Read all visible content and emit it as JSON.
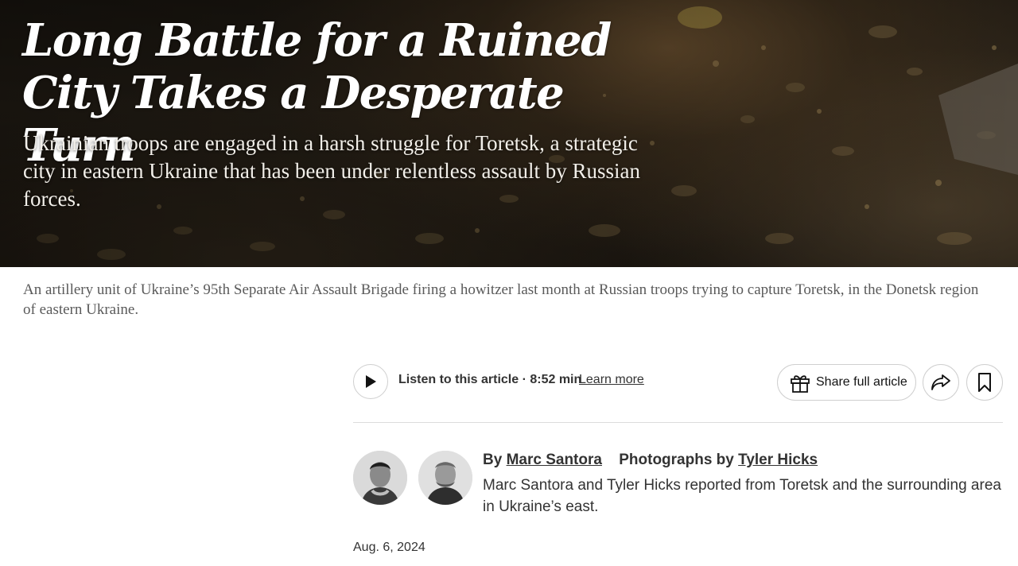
{
  "hero": {
    "headline_line1": "Long Battle for a Ruined",
    "headline_line2": "City Takes a Desperate Turn",
    "dek": "Ukrainian troops are engaged in a harsh struggle for Toretsk, a strategic city in eastern Ukraine that has been under relentless assault by Russian forces."
  },
  "caption": "An artillery unit of Ukraine’s 95th Separate Air Assault Brigade firing a howitzer last month at Russian troops trying to capture Toretsk, in the Donetsk region of eastern Ukraine.",
  "toolbar": {
    "listen_label": "Listen to this article · 8:52 min",
    "learn_more": "Learn more",
    "share_label": "Share full article",
    "icons": [
      "play-icon",
      "gift-icon",
      "share-arrow-icon",
      "bookmark-icon"
    ]
  },
  "byline": {
    "by_prefix": "By",
    "author": "Marc Santora",
    "photos_prefix": "Photographs by",
    "photographer": "Tyler Hicks",
    "note": "Marc Santora and Tyler Hicks reported from Toretsk and the surrounding area in Ukraine’s east."
  },
  "date": "Aug. 6, 2024",
  "colors": {
    "text": "#121212",
    "muted": "#5a5a5a",
    "border": "#cfcfcf"
  }
}
